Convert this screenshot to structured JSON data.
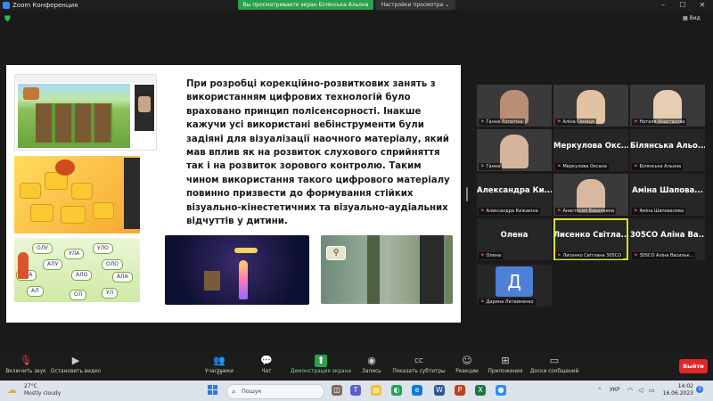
{
  "window": {
    "title": "Zoom Конференция",
    "share_banner": "Вы просматриваете экран Білянська Альона",
    "view_options": "Настройки просмотра ⌄",
    "view_label": "Вид"
  },
  "slide": {
    "text": "При розробці корекційно-розвиткових занять з використанням цифрових технологій було враховано принцип полісенсорності. Інакше кажучи усі використані вебінструменти були задіяні для візуалізації наочного матеріалу, який мав вплив як на розвиток  слухового сприйняття так і  на розвиток зорового контролю. Таким чином використання такого  цифрового матеріалу повинно призвести до формування стійких візуально-кінестетичних та візуально-аудіальних відчуттів у дитини.",
    "syllables": [
      "ОЛУ",
      "УЛА",
      "УЛО",
      "АЛУ",
      "ОЛО",
      "ОЛА",
      "АЛО",
      "АЛА",
      "АЛ",
      "ОЛ",
      "УЛ"
    ]
  },
  "gallery": [
    {
      "id": "hanna",
      "kind": "video",
      "caption": "Ганна Лопатіна",
      "skin": "#b98e77"
    },
    {
      "id": "alina-s",
      "kind": "video",
      "caption": "Аліна Сениця",
      "skin": "#e2c2a2"
    },
    {
      "id": "natalia",
      "kind": "video",
      "caption": "Наталя Анастасова",
      "skin": "#e8cdb2"
    },
    {
      "id": "hanna2",
      "kind": "video",
      "caption": "Ганна",
      "skin": "#d4b49a"
    },
    {
      "id": "merkulova",
      "kind": "name",
      "big": "Меркулова Окс...",
      "caption": "Меркулова Оксана"
    },
    {
      "id": "bilianska",
      "kind": "name",
      "big": "Білянська Альо...",
      "caption": "Білянська Альона"
    },
    {
      "id": "kyzhakina",
      "kind": "name",
      "big": "Александра Ки...",
      "caption": "Александра Кижакіна"
    },
    {
      "id": "vavilkina",
      "kind": "video",
      "caption": "Анастасия Вавилкина",
      "skin": "#d8b89e"
    },
    {
      "id": "shapovalova",
      "kind": "name",
      "big": "Аміна Шапова...",
      "caption": "Аміна Шаповалова"
    },
    {
      "id": "olena",
      "kind": "name",
      "big": "Олена",
      "caption": "Олена"
    },
    {
      "id": "lysenko",
      "kind": "name",
      "big": "Лисенко Світла...",
      "caption": "Лисенко Світлана 305СО",
      "active": true
    },
    {
      "id": "vasylk",
      "kind": "name",
      "big": "305СО Аліна Ва...",
      "caption": "305СО Аліна Васильк..."
    },
    {
      "id": "lytvynenko",
      "kind": "avatar",
      "letter": "Д",
      "caption": "Дарина Литвиненко"
    }
  ],
  "toolbar": {
    "unmute": "Включить звук",
    "video": "Остановить видео",
    "participants": "Участники",
    "participants_count": "13",
    "chat": "Чат",
    "share": "Демонстрация экрана",
    "record": "Запись",
    "captions": "Показать субтитры",
    "reactions": "Реакции",
    "apps": "Приложения",
    "whiteboards": "Доски сообщений",
    "leave": "Выйти"
  },
  "taskbar": {
    "temp": "27°C",
    "condition": "Mostly cloudy",
    "search_placeholder": "Пошук",
    "lang": "УКР",
    "time": "14:02",
    "date": "16.06.2023",
    "notifications": "3"
  },
  "colors": {
    "share_green": "#2aa14a",
    "leave_red": "#e02828",
    "active_speaker": "#d8e11d"
  }
}
